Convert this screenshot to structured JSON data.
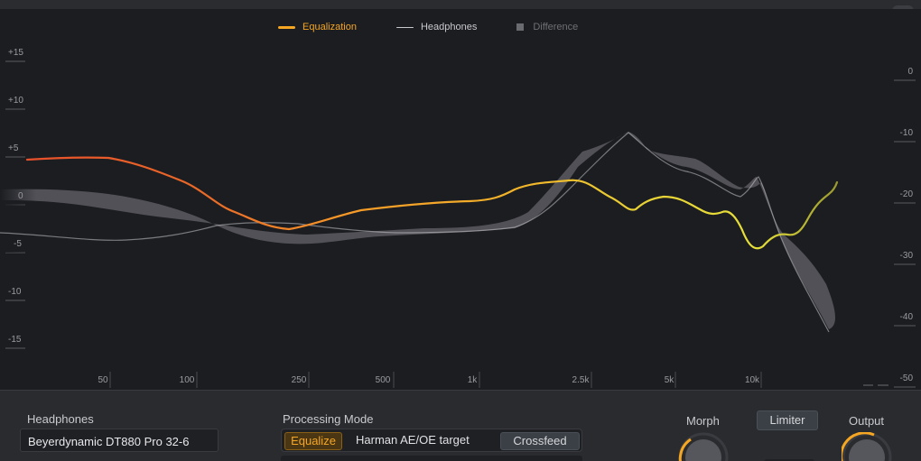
{
  "legend": {
    "equalization": "Equalization",
    "headphones": "Headphones",
    "difference": "Difference"
  },
  "colors": {
    "equalization": "#f5a623",
    "equalization_low": "#e8502b",
    "equalization_high": "#e8e03a",
    "headphones": "#c9c9cc",
    "difference": "#6a6b70",
    "background": "#1c1d21",
    "panel": "#2a2b2f"
  },
  "left_axis": [
    "+15",
    "+10",
    "+5",
    "0",
    "-5",
    "-10",
    "-15"
  ],
  "right_axis": [
    "0",
    "-10",
    "-20",
    "-30",
    "-40",
    "-50"
  ],
  "freq_axis": [
    "50",
    "100",
    "250",
    "500",
    "1k",
    "2.5k",
    "5k",
    "10k"
  ],
  "controls": {
    "headphones_label": "Headphones",
    "headphones_value": "Beyerdynamic DT880 Pro 32-6",
    "processing_mode_label": "Processing Mode",
    "equalize_button": "Equalize",
    "target": "Harman AE/OE target",
    "crossfeed_button": "Crossfeed",
    "morph_label": "Morph",
    "limiter_button": "Limiter",
    "output_label": "Output"
  },
  "icons": {
    "morph_knob": "knob-icon",
    "output_knob": "knob-icon"
  }
}
